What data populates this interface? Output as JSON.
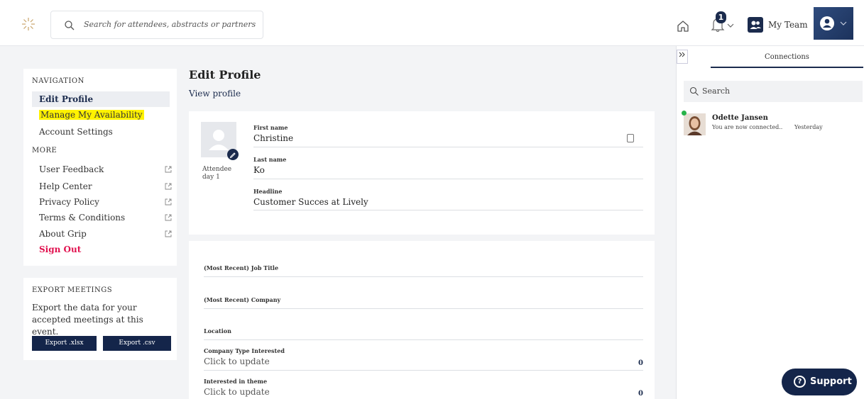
{
  "topbar": {
    "search_placeholder": "Search for attendees, abstracts or partners",
    "notification_count": "1",
    "team_label": "My Team"
  },
  "nav": {
    "section_title": "NAVIGATION",
    "items": [
      {
        "label": "Edit Profile"
      },
      {
        "label": "Manage My Availability"
      },
      {
        "label": "Account Settings"
      }
    ],
    "more_title": "MORE",
    "more_items": [
      {
        "label": "User Feedback"
      },
      {
        "label": "Help Center"
      },
      {
        "label": "Privacy Policy"
      },
      {
        "label": "Terms & Conditions"
      },
      {
        "label": "About Grip"
      }
    ],
    "signout_label": "Sign Out"
  },
  "export": {
    "title": "EXPORT MEETINGS",
    "description": "Export the data for your accepted meetings at this event.",
    "xlsx_label": "Export .xlsx",
    "csv_label": "Export .csv"
  },
  "main": {
    "title": "Edit Profile",
    "view_profile": "View profile",
    "attendee_type": "Attendee day 1",
    "fields": [
      {
        "label": "First name",
        "value": "Christine"
      },
      {
        "label": "Last name",
        "value": "Ko"
      },
      {
        "label": "Headline",
        "value": "Customer Succes at Lively"
      }
    ],
    "details": [
      {
        "label": "(Most Recent) Job Title"
      },
      {
        "label": "(Most Recent) Company"
      },
      {
        "label": "Location"
      },
      {
        "label": "Company Type Interested",
        "value": "Click to update",
        "count": "0"
      },
      {
        "label": "Interested in theme",
        "value": "Click to update",
        "count": "0"
      }
    ]
  },
  "right_panel": {
    "tab_label": "Connections",
    "search_placeholder": "Search",
    "connections": [
      {
        "name": "Odette Jansen",
        "message": "You are now connected..",
        "time": "Yesterday"
      }
    ]
  },
  "support_label": "Support",
  "colors": {
    "accent": "#1b2b4d",
    "signout": "#e1124f",
    "highlight": "#fff200",
    "online": "#27b34a"
  }
}
